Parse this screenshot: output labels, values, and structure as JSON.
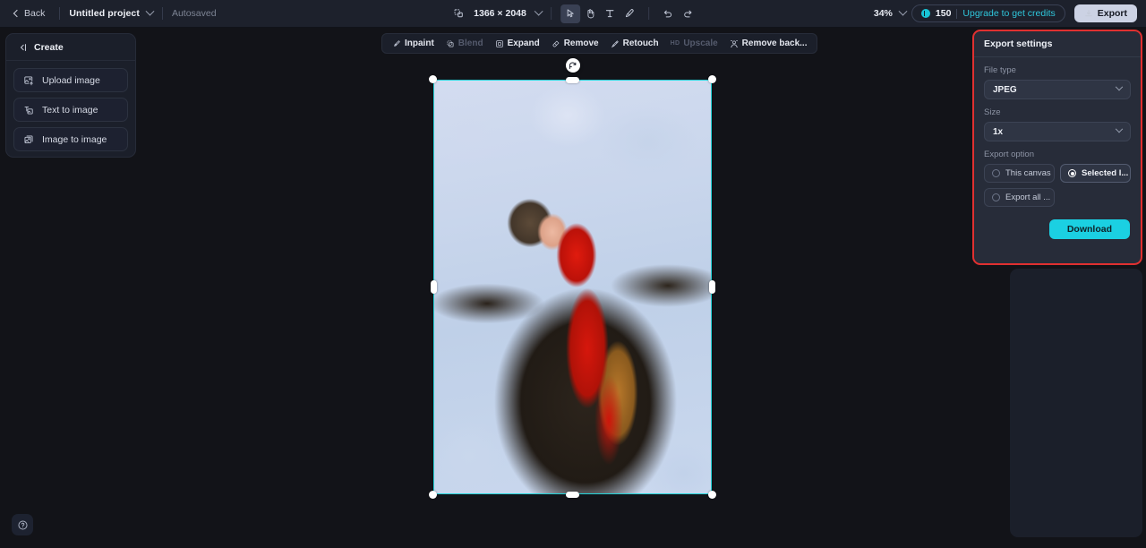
{
  "header": {
    "back_label": "Back",
    "project_name": "Untitled project",
    "autosaved_label": "Autosaved",
    "canvas_dimensions": "1366 × 2048",
    "zoom_level": "34%",
    "credits_count": "150",
    "upgrade_label": "Upgrade to get credits",
    "export_label": "Export",
    "tools": [
      {
        "name": "resize-canvas-icon",
        "label": "Resize canvas",
        "active": false,
        "disabled": false
      },
      {
        "name": "select-tool",
        "label": "Select",
        "active": true,
        "disabled": false
      },
      {
        "name": "hand-tool",
        "label": "Hand",
        "active": false,
        "disabled": false
      },
      {
        "name": "text-tool",
        "label": "Text",
        "active": false,
        "disabled": false
      },
      {
        "name": "brush-tool",
        "label": "Brush",
        "active": false,
        "disabled": false
      },
      {
        "name": "undo-button",
        "label": "Undo",
        "active": false,
        "disabled": false
      },
      {
        "name": "redo-button",
        "label": "Redo",
        "active": false,
        "disabled": true
      }
    ]
  },
  "left_panel": {
    "title": "Create",
    "items": [
      {
        "label": "Upload image",
        "icon": "upload-image-icon"
      },
      {
        "label": "Text to image",
        "icon": "text-to-image-icon"
      },
      {
        "label": "Image to image",
        "icon": "image-to-image-icon"
      }
    ]
  },
  "canvas_toolbar": {
    "items": [
      {
        "label": "Inpaint",
        "icon": "inpaint-icon",
        "disabled": false
      },
      {
        "label": "Blend",
        "icon": "blend-icon",
        "disabled": true
      },
      {
        "label": "Expand",
        "icon": "expand-icon",
        "disabled": false
      },
      {
        "label": "Remove",
        "icon": "remove-icon",
        "disabled": false
      },
      {
        "label": "Retouch",
        "icon": "retouch-icon",
        "disabled": false
      },
      {
        "label": "Upscale",
        "icon": "upscale-icon",
        "disabled": true,
        "badge": "HD"
      },
      {
        "label": "Remove back...",
        "icon": "remove-background-icon",
        "disabled": false
      }
    ]
  },
  "export_panel": {
    "title": "Export settings",
    "file_type_label": "File type",
    "file_type_value": "JPEG",
    "size_label": "Size",
    "size_value": "1x",
    "export_option_label": "Export option",
    "options": [
      {
        "label": "This canvas",
        "selected": false
      },
      {
        "label": "Selected l...",
        "selected": true
      },
      {
        "label": "Export all ...",
        "selected": false
      }
    ],
    "download_label": "Download",
    "highlight_color": "#e03030",
    "accent_color": "#1bd0e2"
  },
  "help": {
    "label": "Help"
  },
  "selection": {
    "visible": true,
    "border_color": "#22d3d8"
  }
}
